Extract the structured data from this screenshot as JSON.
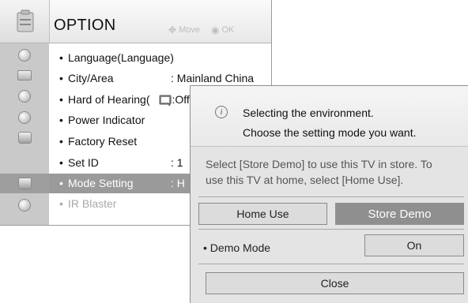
{
  "menu": {
    "title": "OPTION",
    "hint_move": "Move",
    "hint_ok": "OK",
    "items": [
      {
        "label": "Language(Language)",
        "value": ""
      },
      {
        "label": "City/Area",
        "value": ": Mainland China"
      },
      {
        "label": "Hard of Hearing(      ):Off",
        "value": ""
      },
      {
        "label": "Power Indicator",
        "value": ""
      },
      {
        "label": "Factory Reset",
        "value": ""
      },
      {
        "label": "Set ID",
        "value": ": 1"
      },
      {
        "label": "Mode Setting",
        "value": ": H"
      },
      {
        "label": "IR Blaster",
        "value": ""
      }
    ],
    "side_icons": [
      "picture-icon",
      "screen-icon",
      "audio-icon",
      "clock-icon",
      "lock-icon",
      "option-icon",
      "network-icon"
    ]
  },
  "dialog": {
    "line1": "Selecting the environment.",
    "line2": "Choose the setting mode you want.",
    "description_1": "Select [Store Demo] to use this TV in store. To",
    "description_2": "use this TV at home, select [Home Use].",
    "home_use": "Home Use",
    "store_demo": "Store Demo",
    "demo_mode_label": "Demo Mode",
    "demo_mode_value": "On",
    "close": "Close"
  },
  "colors": {
    "selected_row": "#9a9a9a",
    "selected_button": "#8f8f8f"
  }
}
